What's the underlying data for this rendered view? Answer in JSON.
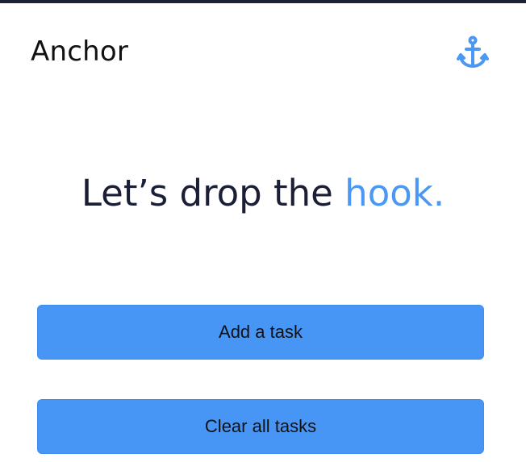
{
  "app": {
    "title": "Anchor",
    "logo_icon": "anchor-icon"
  },
  "hero": {
    "headline_prefix": "Let’s drop the ",
    "headline_accent": "hook."
  },
  "actions": {
    "add_label": "Add a task",
    "clear_label": "Clear all tasks"
  },
  "colors": {
    "accent": "#4a98f3",
    "button": "#4796f6",
    "heading": "#1a1f36"
  }
}
